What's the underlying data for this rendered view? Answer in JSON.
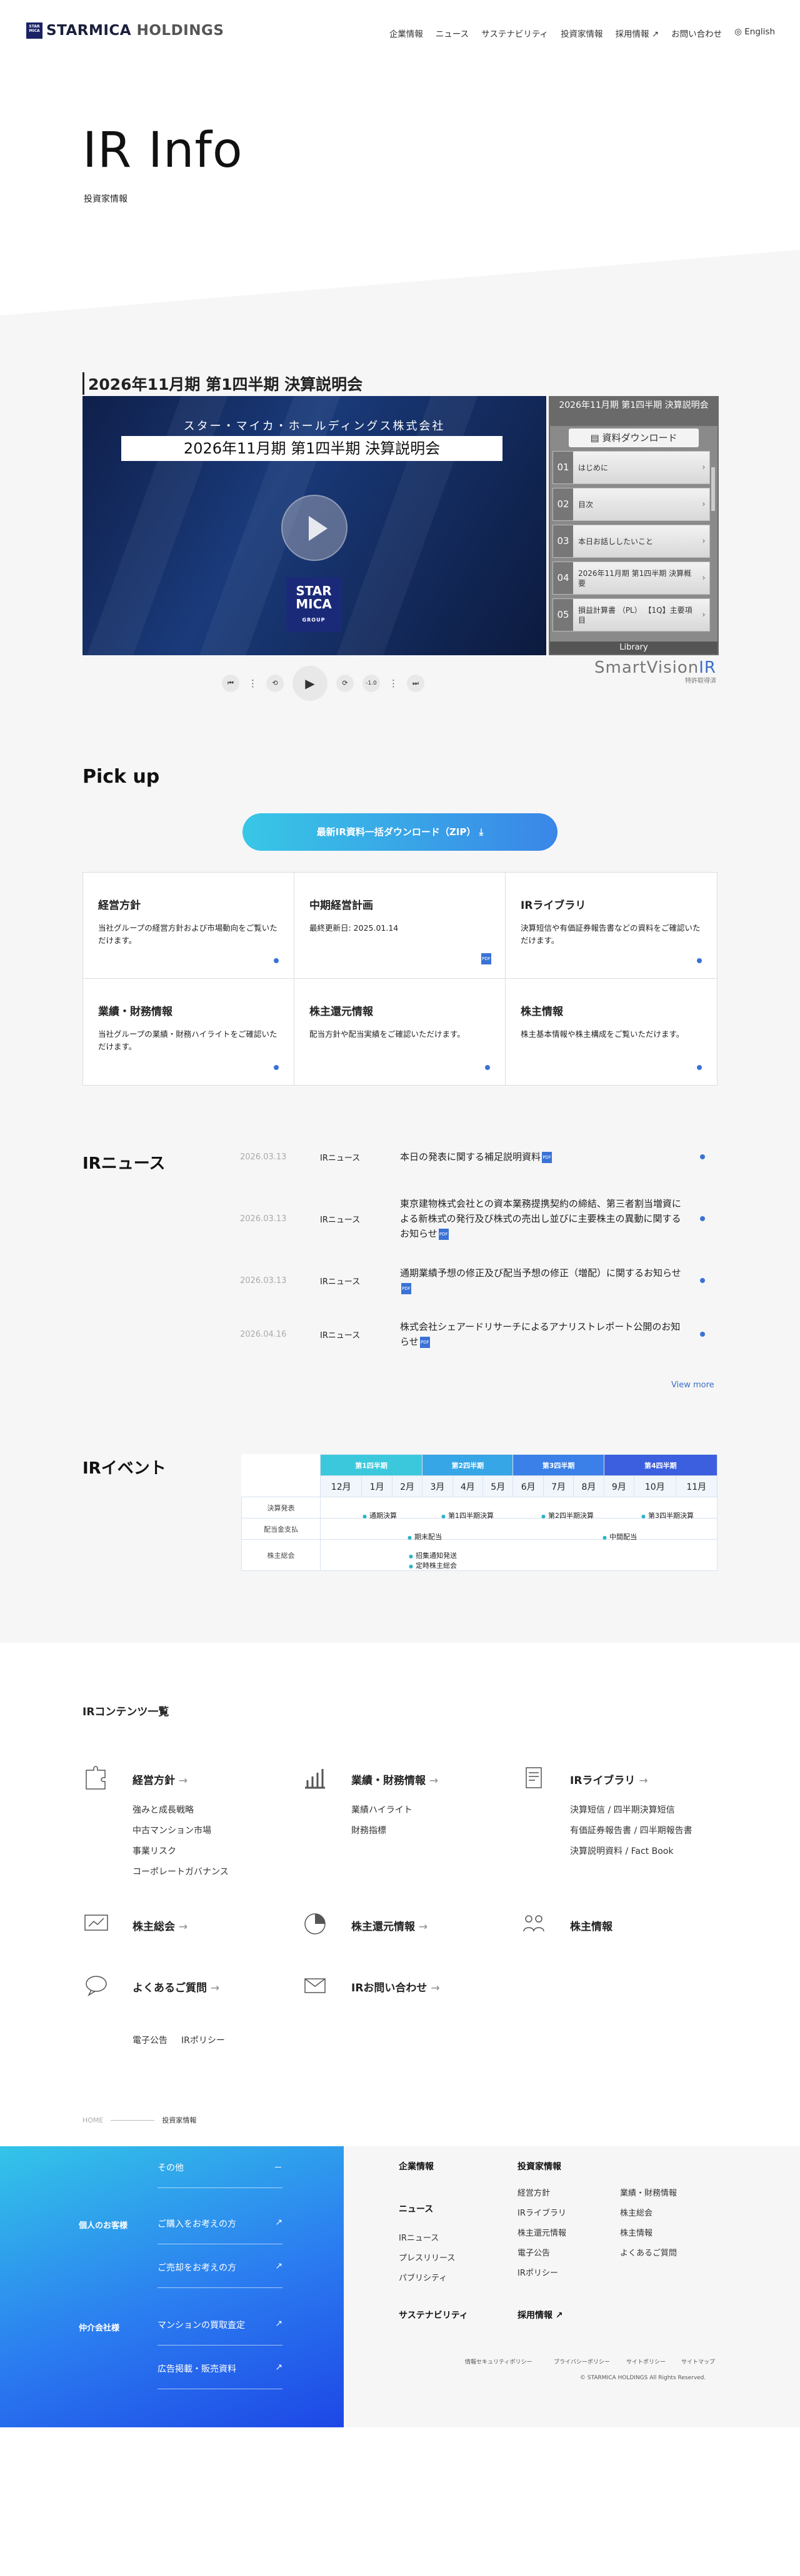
{
  "header": {
    "logo_mark": "STAR MICA",
    "logo_brand": "STARMICA",
    "logo_suffix": " HOLDINGS",
    "nav": [
      "企業情報",
      "ニュース",
      "サステナビリティ",
      "投資家情報",
      "採用情報 ↗",
      "お問い合わせ"
    ],
    "lang": "English"
  },
  "hero": {
    "title": "IR Info",
    "subtitle": "投資家情報"
  },
  "video": {
    "title": "2026年11月期 第1四半期 決算説明会",
    "company": "スター・マイカ・ホールディングス株式会社",
    "banner": "2026年11月期 第1四半期 決算説明会",
    "logo_text": "STAR MICA",
    "logo_sub": "GROUP",
    "sidebar_title": "2026年11月期 第1四半期 決算説明会",
    "download": "資料ダウンロード",
    "chapters": [
      {
        "num": "01",
        "title": "はじめに"
      },
      {
        "num": "02",
        "title": "目次"
      },
      {
        "num": "03",
        "title": "本日お話ししたいこと"
      },
      {
        "num": "04",
        "title": "2026年11月期 第1四半期 決算概要"
      },
      {
        "num": "05",
        "title": "損益計算書 （PL） 【1Q】主要項目"
      }
    ],
    "library": "Library",
    "controls": [
      "⏮",
      "⋮",
      "⟲",
      "▶",
      "⟳",
      "-1.0",
      "⋮",
      "⏭"
    ],
    "brand_main": "SmartVision",
    "brand_ir": "IR",
    "brand_sub": "特許取得済"
  },
  "pickup": {
    "title": "Pick up",
    "download_button": "最新IR資料一括ダウンロード（ZIP）",
    "cards": [
      {
        "title": "経営方針",
        "desc": "当社グループの経営方針および市場動向をご覧いただけます。"
      },
      {
        "title": "中期経営計画",
        "desc": "最終更新日: 2025.01.14"
      },
      {
        "title": "IRライブラリ",
        "desc": "決算短信や有価証券報告書などの資料をご確認いただけます。"
      },
      {
        "title": "業績・財務情報",
        "desc": "当社グループの業績・財務ハイライトをご確認いただけます。"
      },
      {
        "title": "株主還元情報",
        "desc": "配当方針や配当実績をご確認いただけます。"
      },
      {
        "title": "株主情報",
        "desc": "株主基本情報や株主構成をご覧いただけます。"
      }
    ]
  },
  "news": {
    "title": "IRニュース",
    "items": [
      {
        "date": "2026.03.13",
        "category": "IRニュース",
        "title": "本日の発表に関する補足説明資料"
      },
      {
        "date": "2026.03.13",
        "category": "IRニュース",
        "title": "東京建物株式会社との資本業務提携契約の締結、第三者割当増資による新株式の発行及び株式の売出し並びに主要株主の異動に関するお知らせ"
      },
      {
        "date": "2026.03.13",
        "category": "IRニュース",
        "title": "通期業績予想の修正及び配当予想の修正（増配）に関するお知らせ"
      },
      {
        "date": "2026.04.16",
        "category": "IRニュース",
        "title": "株式会社シェアードリサーチによるアナリストレポート公開のお知らせ"
      }
    ],
    "more": "View more"
  },
  "events": {
    "title": "IRイベント",
    "quarters": [
      "第1四半期",
      "第2四半期",
      "第3四半期",
      "第4四半期"
    ],
    "quarter_colors": [
      "#3cc8dc",
      "#36a6e6",
      "#3a80e8",
      "#3c5fe0"
    ],
    "months": [
      "12月",
      "1月",
      "2月",
      "3月",
      "4月",
      "5月",
      "6月",
      "7月",
      "8月",
      "9月",
      "10月",
      "11月"
    ],
    "rows": [
      "決算発表",
      "配当金支払",
      "株主総会"
    ],
    "marks": [
      "通期決算",
      "第1四半期決算",
      "第2四半期決算",
      "第3四半期決算",
      "期末配当",
      "中間配当",
      "招集通知発送",
      "定時株主総会"
    ]
  },
  "contents": {
    "title": "IRコンテンツ一覧",
    "groups": [
      {
        "icon": "puzzle-icon",
        "title": "経営方針",
        "links": [
          "強みと成長戦略",
          "中古マンション市場",
          "事業リスク",
          "コーポレートガバナンス"
        ]
      },
      {
        "icon": "bar-chart-icon",
        "title": "業績・財務情報",
        "links": [
          "業績ハイライト",
          "財務指標"
        ]
      },
      {
        "icon": "document-icon",
        "title": "IRライブラリ",
        "links": [
          "決算短信 / 四半期決算短信",
          "有価証券報告書 / 四半期報告書",
          "決算説明資料 / Fact Book"
        ]
      },
      {
        "icon": "presentation-icon",
        "title": "株主総会",
        "links": []
      },
      {
        "icon": "pie-chart-icon",
        "title": "株主還元情報",
        "links": []
      },
      {
        "icon": "people-icon",
        "title": "株主情報",
        "links": []
      },
      {
        "icon": "chat-icon",
        "title": "よくあるご質問",
        "links": []
      },
      {
        "icon": "mail-icon",
        "title": "IRお問い合わせ",
        "links": []
      }
    ],
    "misc": [
      "電子公告",
      "IRポリシー"
    ]
  },
  "breadcrumb": {
    "home": "HOME",
    "current": "投資家情報"
  },
  "footer": {
    "other": "その他",
    "personal": "個人のお客様",
    "buy": "ご購入をお考えの方",
    "sell": "ご売却をお考えの方",
    "corporate": "仲介会社様",
    "purchase": "マンションの買取査定",
    "ads": "広告掲載・販売資料",
    "company": "企業情報",
    "news": "ニュース",
    "news_links": [
      "IRニュース",
      "プレスリリース",
      "パブリシティ"
    ],
    "sustainability": "サステナビリティ",
    "ir": "投資家情報",
    "ir_col1": [
      "経営方針",
      "IRライブラリ",
      "株主還元情報",
      "電子公告",
      "IRポリシー"
    ],
    "ir_col2": [
      "業績・財務情報",
      "株主総会",
      "株主情報",
      "よくあるご質問"
    ],
    "recruit": "採用情報 ↗",
    "bottom_links": [
      "情報セキュリティポリシー",
      "プライバシーポリシー",
      "サイトポリシー",
      "サイトマップ"
    ],
    "copyright": "© STARMICA HOLDINGS All Rights Reserved."
  },
  "colors": {
    "accent": "#3a72d6",
    "gradient_start": "#38c7e6",
    "gradient_end": "#3a86e8"
  }
}
